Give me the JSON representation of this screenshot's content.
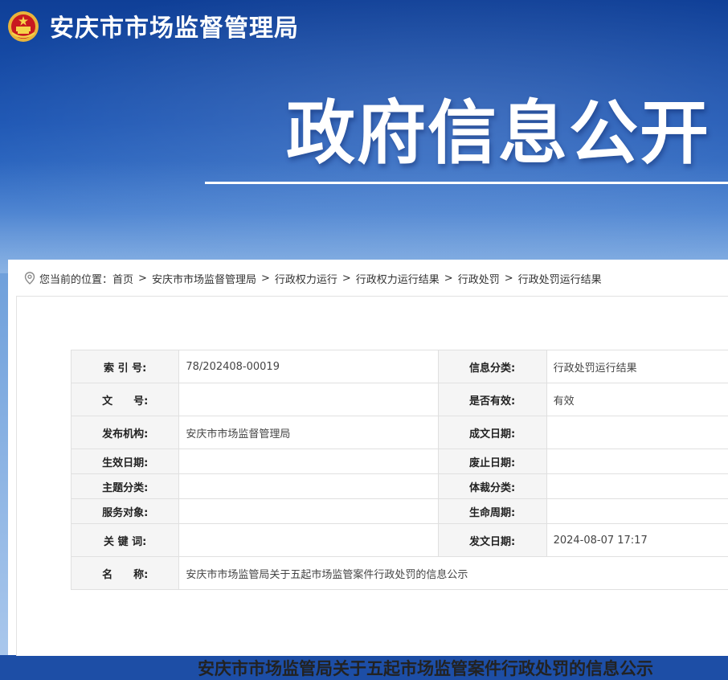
{
  "header": {
    "agency_name": "安庆市市场监督管理局",
    "banner_slogan": "政府信息公开"
  },
  "breadcrumb": {
    "prefix": "您当前的位置：",
    "items": [
      "首页",
      "安庆市市场监督管理局",
      "行政权力运行",
      "行政权力运行结果",
      "行政处罚",
      "行政处罚运行结果"
    ],
    "separator": ">"
  },
  "meta": {
    "index_no": {
      "label": "索 引 号:",
      "value": "78/202408-00019"
    },
    "info_category": {
      "label": "信息分类:",
      "value": "行政处罚运行结果"
    },
    "doc_no": {
      "label": "文　　号:",
      "value": ""
    },
    "is_valid": {
      "label": "是否有效:",
      "value": "有效"
    },
    "publisher": {
      "label": "发布机构:",
      "value": "安庆市市场监督管理局"
    },
    "written_date": {
      "label": "成文日期:",
      "value": ""
    },
    "effective_date": {
      "label": "生效日期:",
      "value": ""
    },
    "abolish_date": {
      "label": "废止日期:",
      "value": ""
    },
    "topic_category": {
      "label": "主题分类:",
      "value": ""
    },
    "genre_category": {
      "label": "体裁分类:",
      "value": ""
    },
    "service_target": {
      "label": "服务对象:",
      "value": ""
    },
    "lifecycle": {
      "label": "生命周期:",
      "value": ""
    },
    "keywords": {
      "label": "关 键 词:",
      "value": ""
    },
    "publish_date": {
      "label": "发文日期:",
      "value": "2024-08-07 17:17"
    },
    "name": {
      "label": "名　　称:",
      "value": "安庆市市场监管局关于五起市场监管案件行政处罚的信息公示"
    }
  },
  "article": {
    "title": "安庆市市场监管局关于五起市场监管案件行政处罚的信息公示"
  },
  "colors": {
    "banner_top": "#0f3f97",
    "banner_bottom": "#6fa0db",
    "label_bg": "#f5f5f5",
    "border": "#e0e0e0"
  },
  "icons": {
    "emblem": "national-emblem-icon",
    "location": "location-pin-icon"
  }
}
